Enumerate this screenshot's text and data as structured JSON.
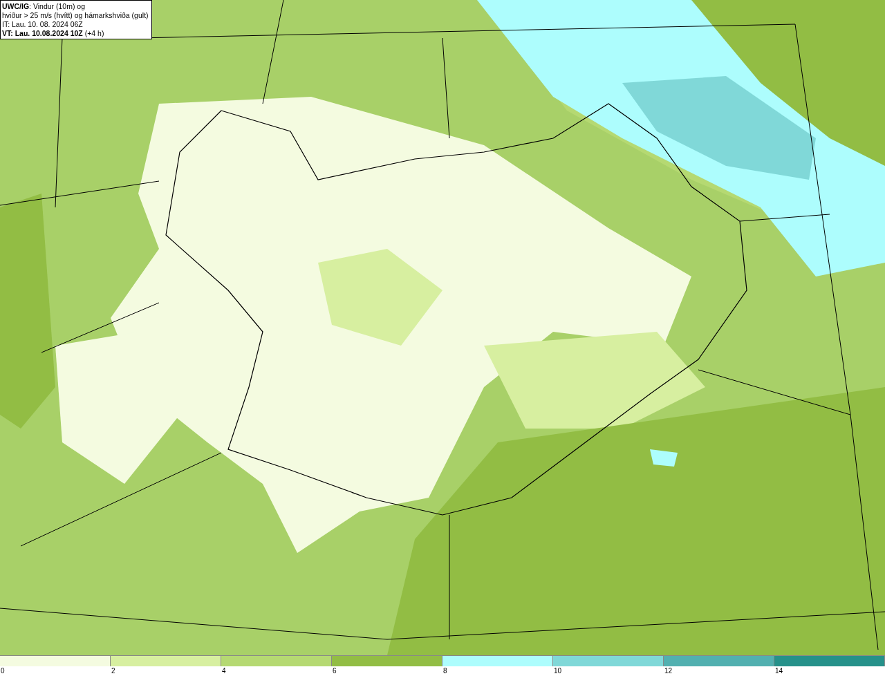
{
  "info_box": {
    "lines": [
      "**UWC/IG**: Vindur (10m) og",
      "hviður > 25 m/s (hvítt) og hámarkshviða (gult)",
      "IT: Lau. 10. 08. 2024 06Z",
      "**VT: Lau. 10.08.2024 10Z** (+4 h)"
    ]
  },
  "color_scale": {
    "items": [
      {
        "label": "0",
        "color": "#f4fbe0"
      },
      {
        "label": "2",
        "color": "#d7efa0"
      },
      {
        "label": "4",
        "color": "#b5d972"
      },
      {
        "label": "6",
        "color": "#92bd44"
      },
      {
        "label": "8",
        "color": "#adfdfd"
      },
      {
        "label": "10",
        "color": "#80d8d8"
      },
      {
        "label": "12",
        "color": "#52b0b0"
      },
      {
        "label": "14",
        "color": "#26918a"
      }
    ]
  }
}
